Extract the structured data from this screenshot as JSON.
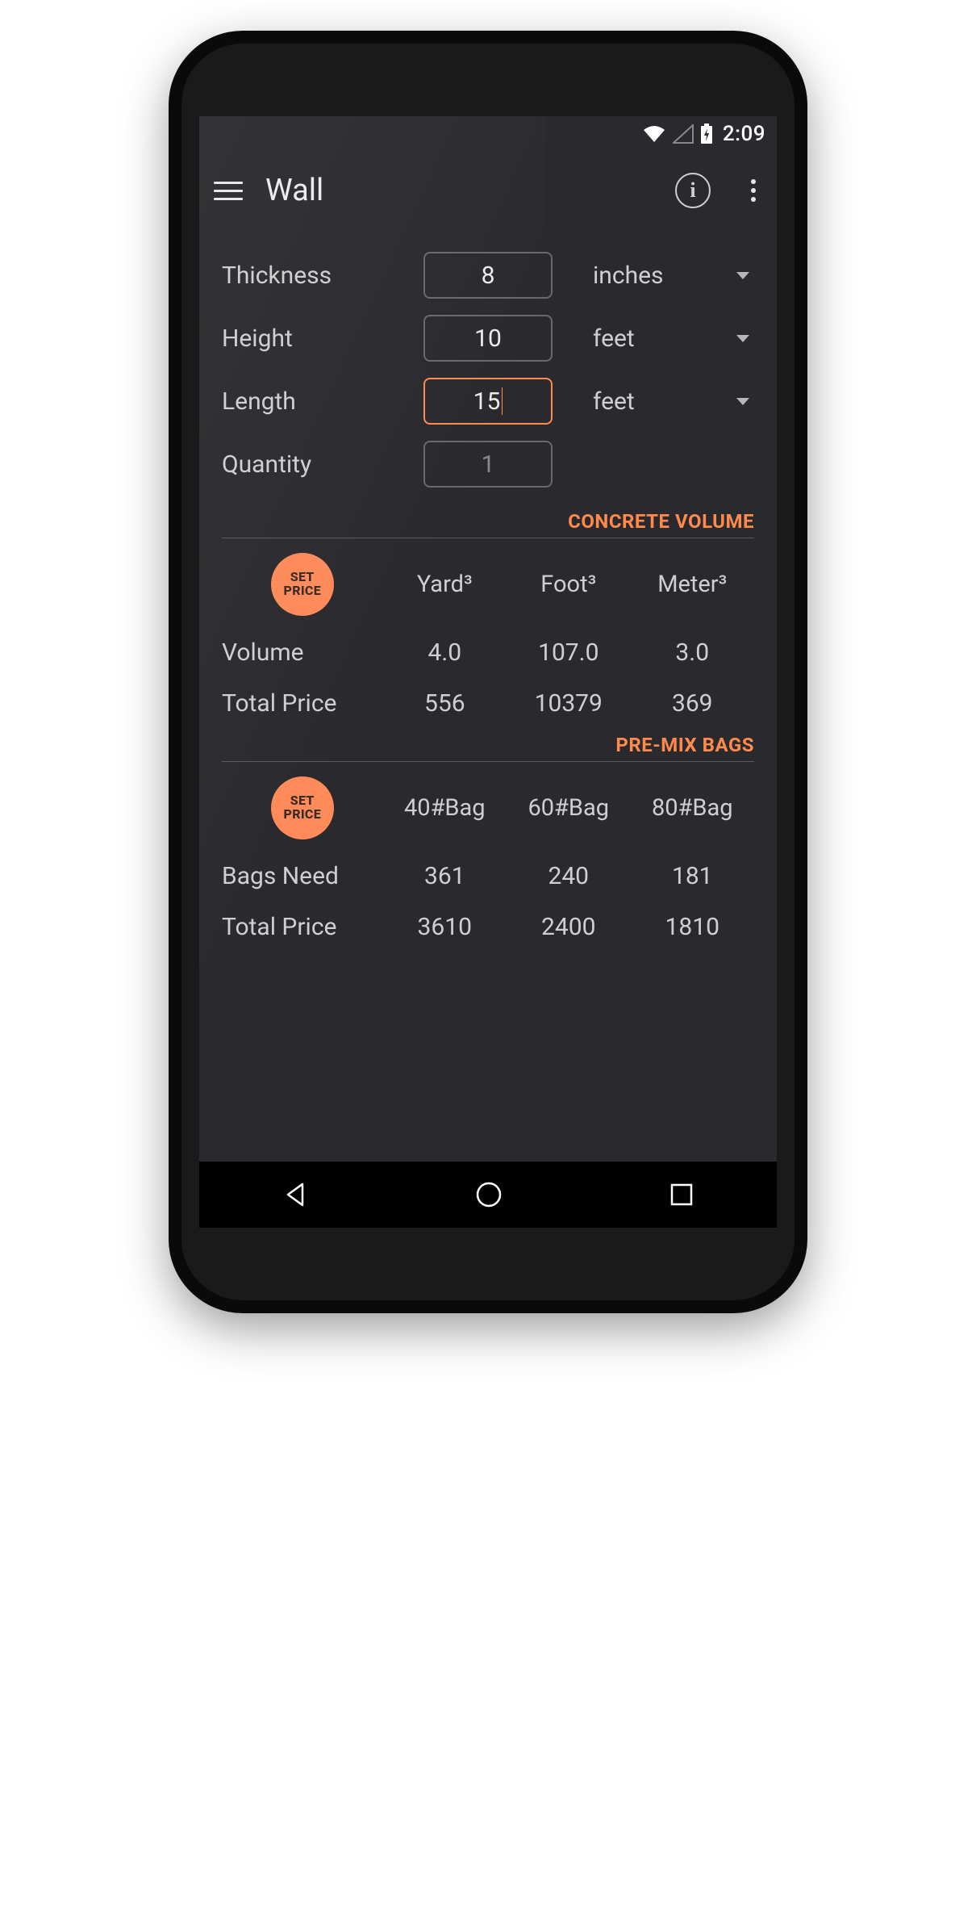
{
  "status": {
    "time": "2:09"
  },
  "header": {
    "title": "Wall"
  },
  "inputs": {
    "thickness": {
      "label": "Thickness",
      "value": "8",
      "unit": "inches"
    },
    "height": {
      "label": "Height",
      "value": "10",
      "unit": "feet"
    },
    "length": {
      "label": "Length",
      "value": "15",
      "unit": "feet",
      "active": true
    },
    "quantity": {
      "label": "Quantity",
      "value": "1"
    }
  },
  "sections": {
    "volume": {
      "title": "CONCRETE VOLUME",
      "set_price": "SET PRICE",
      "cols": [
        "Yard³",
        "Foot³",
        "Meter³"
      ],
      "rows": [
        {
          "label": "Volume",
          "vals": [
            "4.0",
            "107.0",
            "3.0"
          ]
        },
        {
          "label": "Total Price",
          "vals": [
            "556",
            "10379",
            "369"
          ]
        }
      ]
    },
    "bags": {
      "title": "PRE-MIX BAGS",
      "set_price": "SET PRICE",
      "cols": [
        "40#Bag",
        "60#Bag",
        "80#Bag"
      ],
      "rows": [
        {
          "label": "Bags Need",
          "vals": [
            "361",
            "240",
            "181"
          ]
        },
        {
          "label": "Total Price",
          "vals": [
            "3610",
            "2400",
            "1810"
          ]
        }
      ]
    }
  }
}
